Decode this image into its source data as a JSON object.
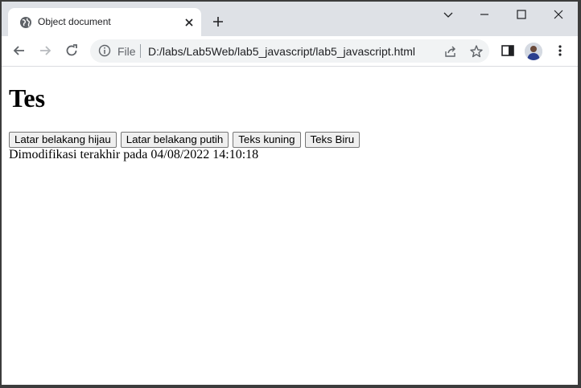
{
  "browser": {
    "tab": {
      "title": "Object document"
    },
    "omnibox": {
      "scheme_label": "File",
      "url": "D:/labs/Lab5Web/lab5_javascript/lab5_javascript.html"
    }
  },
  "page": {
    "heading": "Tes",
    "buttons": [
      {
        "label": "Latar belakang hijau"
      },
      {
        "label": "Latar belakang putih"
      },
      {
        "label": "Teks kuning"
      },
      {
        "label": "Teks Biru"
      }
    ],
    "last_modified": "Dimodifikasi terakhir pada 04/08/2022 14:10:18"
  },
  "colors": {
    "tabstrip_bg": "#dee1e6",
    "omnibox_bg": "#f1f3f4",
    "icon_gray": "#5f6368"
  },
  "icons": {
    "tab_favicon": "globe-icon",
    "tab_close": "close-icon",
    "new_tab": "plus-icon",
    "back": "arrow-left-icon",
    "forward": "arrow-right-icon",
    "reload": "reload-icon",
    "site_info": "info-icon",
    "share": "share-icon",
    "bookmark": "star-icon",
    "side_panel": "side-panel-icon",
    "menu": "kebab-menu-icon"
  }
}
